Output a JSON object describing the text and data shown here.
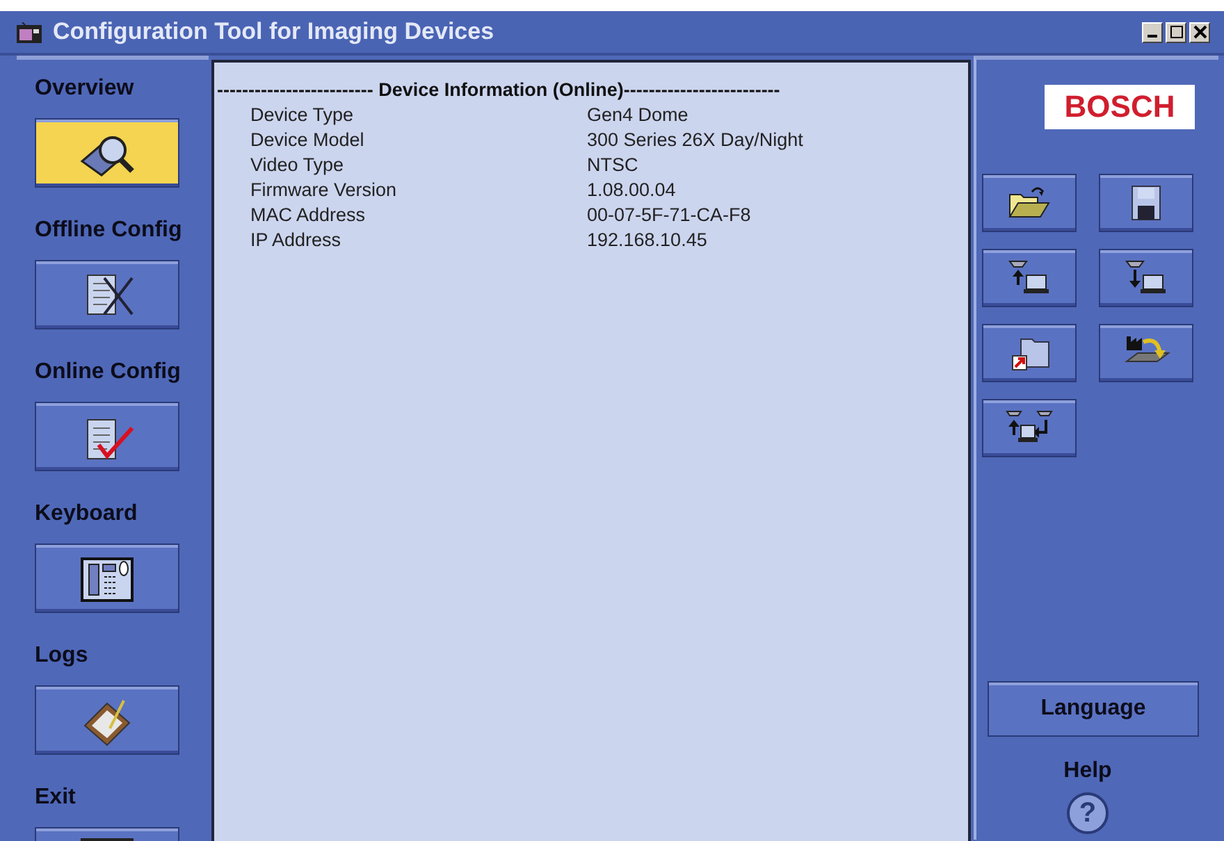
{
  "window": {
    "title": "Configuration Tool for Imaging Devices"
  },
  "sidebar": {
    "items": [
      {
        "label": "Overview",
        "kind": "overview",
        "selected": true
      },
      {
        "label": "Offline Config",
        "kind": "offline",
        "selected": false
      },
      {
        "label": "Online Config",
        "kind": "online",
        "selected": false
      },
      {
        "label": "Keyboard",
        "kind": "keyboard",
        "selected": false
      },
      {
        "label": "Logs",
        "kind": "logs",
        "selected": false
      },
      {
        "label": "Exit",
        "kind": "exit",
        "selected": false
      }
    ]
  },
  "device_info": {
    "heading": "------------------------- Device Information (Online)-------------------------",
    "rows": [
      {
        "label": "Device Type",
        "value": "Gen4 Dome"
      },
      {
        "label": "Device Model",
        "value": "300 Series 26X Day/Night"
      },
      {
        "label": "Video Type",
        "value": "NTSC"
      },
      {
        "label": "Firmware Version",
        "value": "1.08.00.04"
      },
      {
        "label": "MAC Address",
        "value": "00-07-5F-71-CA-F8"
      },
      {
        "label": "IP Address",
        "value": "192.168.10.45"
      }
    ]
  },
  "right_panel": {
    "logo": "BOSCH",
    "tools": [
      {
        "kind": "open"
      },
      {
        "kind": "save"
      },
      {
        "kind": "upload"
      },
      {
        "kind": "download"
      },
      {
        "kind": "shortcut"
      },
      {
        "kind": "factory"
      },
      {
        "kind": "transfer"
      }
    ],
    "language_button": "Language",
    "help_label": "Help",
    "help_icon": "?"
  }
}
